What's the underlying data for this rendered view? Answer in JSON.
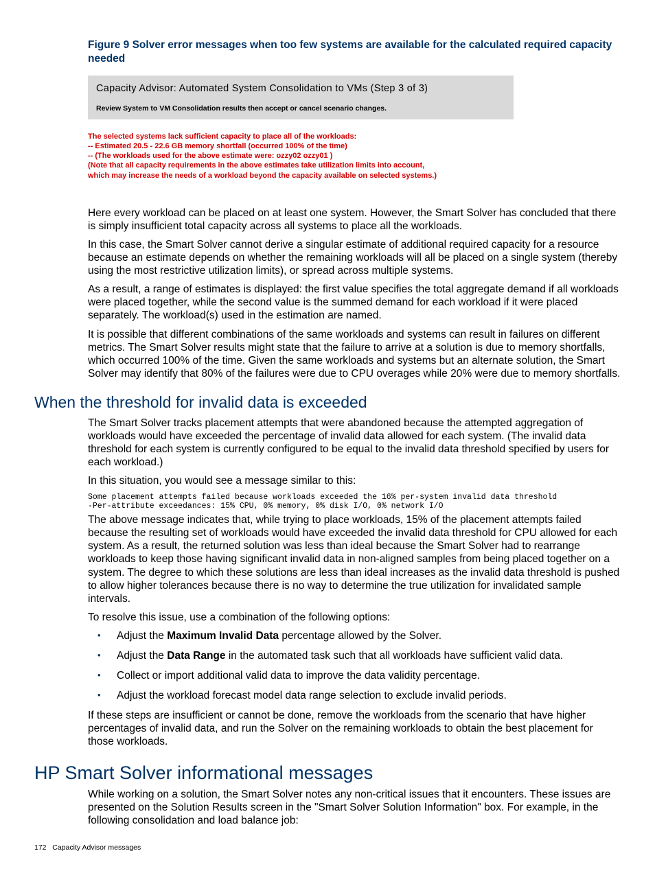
{
  "figure": {
    "caption": "Figure 9 Solver error messages when too few systems are available for the calculated required capacity needed"
  },
  "errorBox": {
    "title": "Capacity Advisor: Automated System Consolidation to VMs (Step 3 of 3)",
    "subtitle": "Review System to VM Consolidation results then accept or cancel scenario changes."
  },
  "red": {
    "l1": "The selected systems lack sufficient capacity to place all of the workloads:",
    "l2": "-- Estimated 20.5 - 22.6 GB memory shortfall (occurred 100% of the time)",
    "l3": "-- (The workloads used for the above estimate were: ozzy02 ozzy01 )",
    "l4": "(Note that all capacity requirements in the above estimates take utilization limits into account,",
    "l5": "which may increase the needs of a workload beyond the capacity available on selected systems.)"
  },
  "p1": "Here every workload can be placed on at least one system. However, the Smart Solver has concluded that there is simply insufficient total capacity across all systems to place all the workloads.",
  "p2": "In this case, the Smart Solver cannot derive a singular estimate of additional required capacity for a resource because an estimate depends on whether the remaining workloads will all be placed on a single system (thereby using the most restrictive utilization limits), or spread across multiple systems.",
  "p3": "As a result, a range of estimates is displayed: the first value specifies the total aggregate demand if all workloads were placed together, while the second value is the summed demand for each workload if it were placed separately. The workload(s) used in the estimation are named.",
  "p4": "It is possible that different combinations of the same workloads and systems can result in failures on different metrics. The Smart Solver results might state that the failure to arrive at a solution is due to memory shortfalls, which occurred 100% of the time. Given the same workloads and systems but an alternate solution, the Smart Solver may identify that 80% of the failures were due to CPU overages while 20% were due to memory shortfalls.",
  "h2a": "When the threshold for invalid data is exceeded",
  "p5": "The Smart Solver tracks placement attempts that were abandoned because the attempted aggregation of workloads would have exceeded the percentage of invalid data allowed for each system. (The invalid data threshold for each system is currently configured to be equal to the invalid data threshold specified by users for each workload.)",
  "p6": "In this situation, you would see a message similar to this:",
  "code1": "Some placement attempts failed because workloads exceeded the 16% per-system invalid data threshold\n-Per-attribute exceedances: 15% CPU, 0% memory, 0% disk I/O, 0% network I/O",
  "p7": "The above message indicates that, while trying to place workloads, 15% of the placement attempts failed because the resulting set of workloads would have exceeded the invalid data threshold for CPU allowed for each system. As a result, the returned solution was less than ideal because the Smart Solver had to rearrange workloads to keep those having significant invalid data in non-aligned samples from being placed together on a system. The degree to which these solutions are less than ideal increases as the invalid data threshold is pushed to allow higher tolerances because there is no way to determine the true utilization for invalidated sample intervals.",
  "p8": "To resolve this issue, use a combination of the following options:",
  "bullets": {
    "b1a": "Adjust the ",
    "b1b": "Maximum Invalid Data",
    "b1c": " percentage allowed by the Solver.",
    "b2a": "Adjust the ",
    "b2b": "Data Range",
    "b2c": " in the automated task such that all workloads have sufficient valid data.",
    "b3": "Collect or import additional valid data to improve the data validity percentage.",
    "b4": "Adjust the workload forecast model data range selection to exclude invalid periods."
  },
  "p9": "If these steps are insufficient or cannot be done, remove the workloads from the scenario that have higher percentages of invalid data, and run the Solver on the remaining workloads to obtain the best placement for those workloads.",
  "h1a": "HP Smart Solver informational messages",
  "p10": "While working on a solution, the Smart Solver notes any non-critical issues that it encounters. These issues are presented on the Solution Results screen in the \"Smart Solver Solution Information\" box. For example, in the following consolidation and load balance job:",
  "footer": {
    "pageNum": "172",
    "section": "Capacity Advisor messages"
  }
}
